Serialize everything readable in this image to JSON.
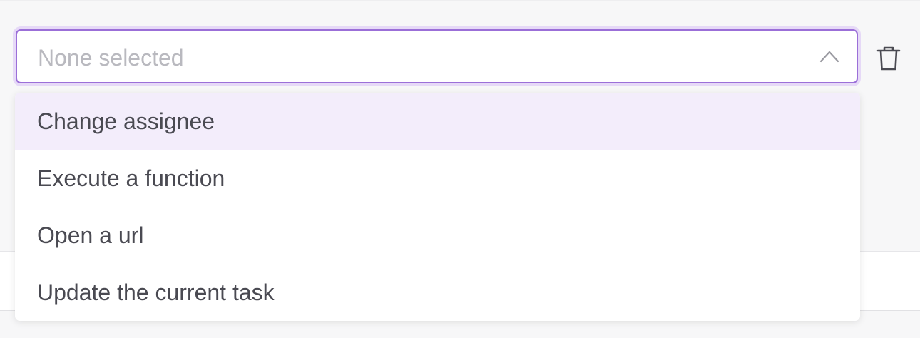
{
  "select": {
    "placeholder": "None selected",
    "expanded": true,
    "chevron_icon": "chevron-up-icon",
    "focus_color": "#9b6fd8"
  },
  "delete": {
    "icon": "trash-icon"
  },
  "dropdown": {
    "options": [
      {
        "label": "Change assignee",
        "highlighted": true
      },
      {
        "label": "Execute a function",
        "highlighted": false
      },
      {
        "label": "Open a url",
        "highlighted": false
      },
      {
        "label": "Update the current task",
        "highlighted": false
      }
    ],
    "highlight_color": "#f3edfb"
  }
}
